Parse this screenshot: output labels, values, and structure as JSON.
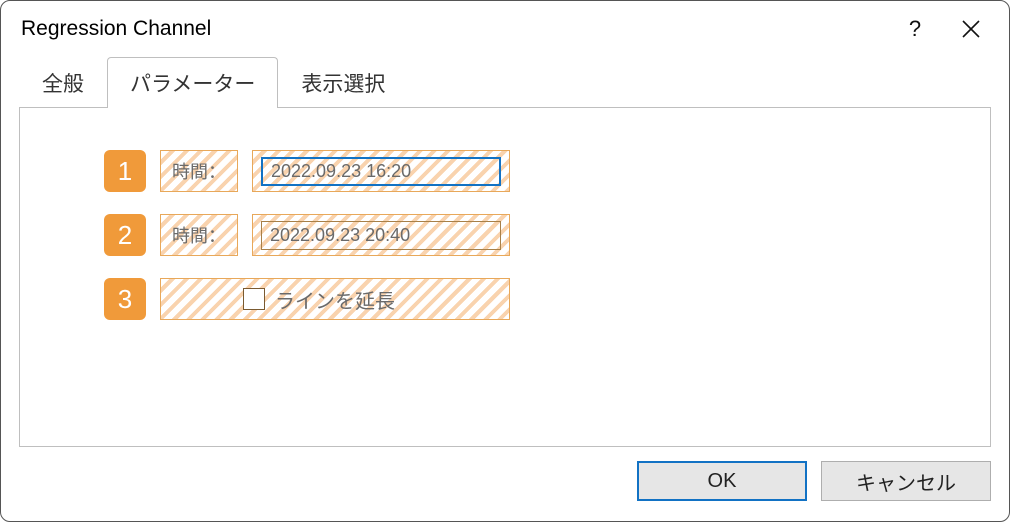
{
  "window": {
    "title": "Regression Channel"
  },
  "tabs": {
    "general": "全般",
    "parameters": "パラメーター",
    "display": "表示選択"
  },
  "params": {
    "row1": {
      "num": "1",
      "label": "時間：",
      "value": "2022.09.23 16:20"
    },
    "row2": {
      "num": "2",
      "label": "時間：",
      "value": "2022.09.23 20:40"
    },
    "row3": {
      "num": "3",
      "checkbox_label": "ラインを延長"
    }
  },
  "buttons": {
    "ok": "OK",
    "cancel": "キャンセル"
  }
}
